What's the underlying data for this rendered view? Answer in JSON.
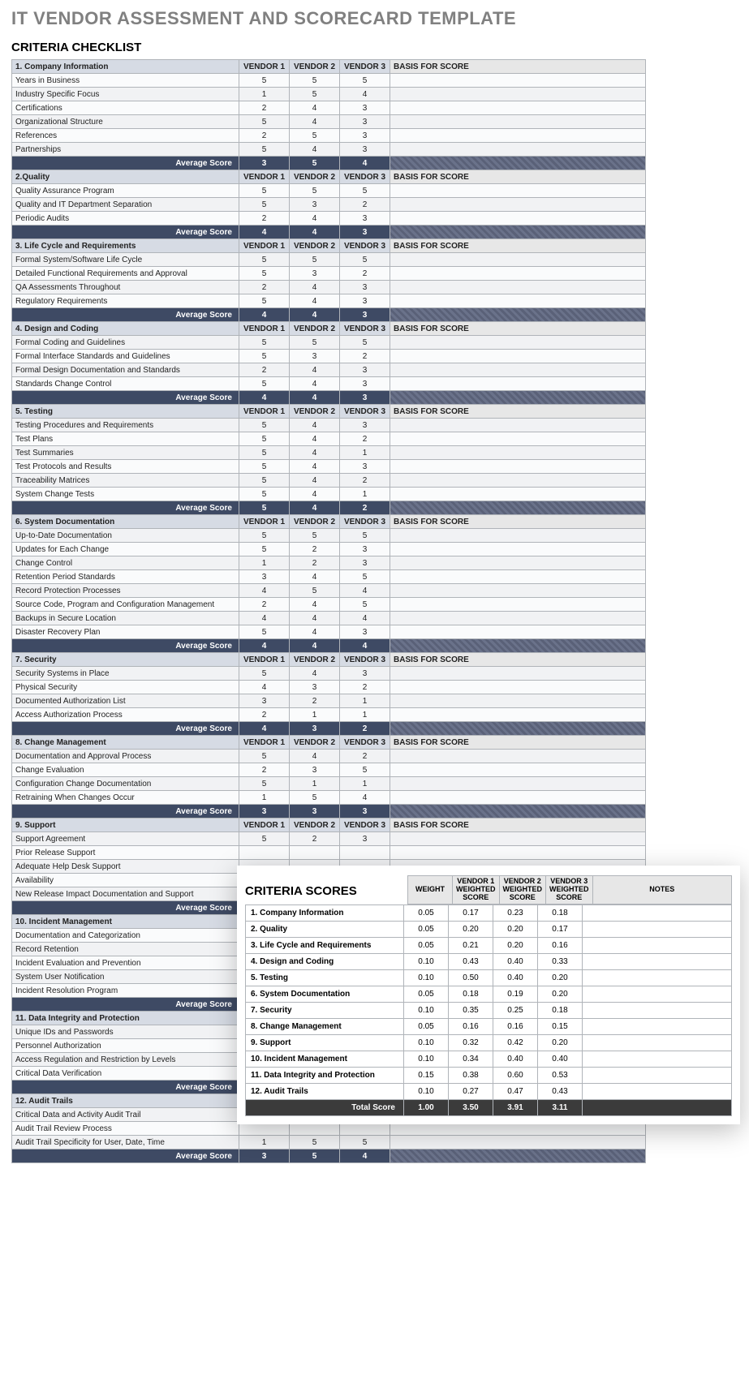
{
  "title": "IT VENDOR ASSESSMENT AND SCORECARD TEMPLATE",
  "checklist_title": "CRITERIA CHECKLIST",
  "col_headers": [
    "VENDOR 1",
    "VENDOR 2",
    "VENDOR 3",
    "BASIS FOR SCORE"
  ],
  "avg_label": "Average Score",
  "sections": [
    {
      "title": "1. Company Information",
      "avg": [
        "3",
        "5",
        "4"
      ],
      "rows": [
        {
          "l": "Years in Business",
          "v": [
            "5",
            "5",
            "5"
          ]
        },
        {
          "l": "Industry Specific Focus",
          "v": [
            "1",
            "5",
            "4"
          ]
        },
        {
          "l": "Certifications",
          "v": [
            "2",
            "4",
            "3"
          ]
        },
        {
          "l": "Organizational Structure",
          "v": [
            "5",
            "4",
            "3"
          ]
        },
        {
          "l": "References",
          "v": [
            "2",
            "5",
            "3"
          ]
        },
        {
          "l": "Partnerships",
          "v": [
            "5",
            "4",
            "3"
          ]
        }
      ]
    },
    {
      "title": "2.Quality",
      "avg": [
        "4",
        "4",
        "3"
      ],
      "rows": [
        {
          "l": "Quality Assurance Program",
          "v": [
            "5",
            "5",
            "5"
          ]
        },
        {
          "l": "Quality and IT Department Separation",
          "v": [
            "5",
            "3",
            "2"
          ]
        },
        {
          "l": "Periodic Audits",
          "v": [
            "2",
            "4",
            "3"
          ]
        }
      ]
    },
    {
      "title": "3. Life Cycle and Requirements",
      "avg": [
        "4",
        "4",
        "3"
      ],
      "rows": [
        {
          "l": "Formal System/Software Life Cycle",
          "v": [
            "5",
            "5",
            "5"
          ]
        },
        {
          "l": "Detailed Functional Requirements and Approval",
          "v": [
            "5",
            "3",
            "2"
          ]
        },
        {
          "l": "QA Assessments Throughout",
          "v": [
            "2",
            "4",
            "3"
          ]
        },
        {
          "l": "Regulatory Requirements",
          "v": [
            "5",
            "4",
            "3"
          ]
        }
      ]
    },
    {
      "title": "4. Design and Coding",
      "avg": [
        "4",
        "4",
        "3"
      ],
      "rows": [
        {
          "l": "Formal Coding and Guidelines",
          "v": [
            "5",
            "5",
            "5"
          ]
        },
        {
          "l": "Formal Interface Standards and Guidelines",
          "v": [
            "5",
            "3",
            "2"
          ]
        },
        {
          "l": "Formal Design Documentation and Standards",
          "v": [
            "2",
            "4",
            "3"
          ]
        },
        {
          "l": "Standards Change Control",
          "v": [
            "5",
            "4",
            "3"
          ]
        }
      ]
    },
    {
      "title": "5. Testing",
      "avg": [
        "5",
        "4",
        "2"
      ],
      "rows": [
        {
          "l": "Testing Procedures and Requirements",
          "v": [
            "5",
            "4",
            "3"
          ]
        },
        {
          "l": "Test Plans",
          "v": [
            "5",
            "4",
            "2"
          ]
        },
        {
          "l": "Test Summaries",
          "v": [
            "5",
            "4",
            "1"
          ]
        },
        {
          "l": "Test Protocols and Results",
          "v": [
            "5",
            "4",
            "3"
          ]
        },
        {
          "l": "Traceability Matrices",
          "v": [
            "5",
            "4",
            "2"
          ]
        },
        {
          "l": "System Change Tests",
          "v": [
            "5",
            "4",
            "1"
          ]
        }
      ]
    },
    {
      "title": "6. System Documentation",
      "avg": [
        "4",
        "4",
        "4"
      ],
      "rows": [
        {
          "l": "Up-to-Date Documentation",
          "v": [
            "5",
            "5",
            "5"
          ]
        },
        {
          "l": "Updates for Each Change",
          "v": [
            "5",
            "2",
            "3"
          ]
        },
        {
          "l": "Change Control",
          "v": [
            "1",
            "2",
            "3"
          ]
        },
        {
          "l": "Retention Period Standards",
          "v": [
            "3",
            "4",
            "5"
          ]
        },
        {
          "l": "Record Protection Processes",
          "v": [
            "4",
            "5",
            "4"
          ]
        },
        {
          "l": "Source Code, Program and Configuration Management",
          "v": [
            "2",
            "4",
            "5"
          ]
        },
        {
          "l": "Backups in Secure Location",
          "v": [
            "4",
            "4",
            "4"
          ]
        },
        {
          "l": "Disaster Recovery Plan",
          "v": [
            "5",
            "4",
            "3"
          ]
        }
      ]
    },
    {
      "title": "7. Security",
      "avg": [
        "4",
        "3",
        "2"
      ],
      "rows": [
        {
          "l": "Security Systems in Place",
          "v": [
            "5",
            "4",
            "3"
          ]
        },
        {
          "l": "Physical Security",
          "v": [
            "4",
            "3",
            "2"
          ]
        },
        {
          "l": "Documented Authorization List",
          "v": [
            "3",
            "2",
            "1"
          ]
        },
        {
          "l": "Access Authorization Process",
          "v": [
            "2",
            "1",
            "1"
          ]
        }
      ]
    },
    {
      "title": "8. Change Management",
      "avg": [
        "3",
        "3",
        "3"
      ],
      "rows": [
        {
          "l": "Documentation and Approval Process",
          "v": [
            "5",
            "4",
            "2"
          ]
        },
        {
          "l": "Change Evaluation",
          "v": [
            "2",
            "3",
            "5"
          ]
        },
        {
          "l": "Configuration Change Documentation",
          "v": [
            "5",
            "1",
            "1"
          ]
        },
        {
          "l": "Retraining When Changes Occur",
          "v": [
            "1",
            "5",
            "4"
          ]
        }
      ]
    },
    {
      "title": "9. Support",
      "avg": [
        "",
        "",
        ""
      ],
      "rows": [
        {
          "l": "Support Agreement",
          "v": [
            "5",
            "2",
            "3"
          ]
        },
        {
          "l": "Prior Release Support",
          "v": [
            "",
            "",
            ""
          ]
        },
        {
          "l": "Adequate Help Desk Support",
          "v": [
            "",
            "",
            ""
          ]
        },
        {
          "l": "Availability",
          "v": [
            "",
            "",
            ""
          ]
        },
        {
          "l": "New Release Impact Documentation and Support",
          "v": [
            "",
            "",
            ""
          ]
        }
      ]
    },
    {
      "title": "10. Incident Management",
      "avg": [
        "",
        "",
        ""
      ],
      "rows": [
        {
          "l": "Documentation and Categorization",
          "v": [
            "",
            "",
            ""
          ]
        },
        {
          "l": "Record Retention",
          "v": [
            "",
            "",
            ""
          ]
        },
        {
          "l": "Incident Evaluation and Prevention",
          "v": [
            "",
            "",
            ""
          ]
        },
        {
          "l": "System User Notification",
          "v": [
            "",
            "",
            ""
          ]
        },
        {
          "l": "Incident Resolution Program",
          "v": [
            "",
            "",
            ""
          ]
        }
      ]
    },
    {
      "title": "11. Data Integrity and Protection",
      "avg": [
        "",
        "",
        ""
      ],
      "rows": [
        {
          "l": "Unique IDs and Passwords",
          "v": [
            "",
            "",
            ""
          ]
        },
        {
          "l": "Personnel Authorization",
          "v": [
            "",
            "",
            ""
          ]
        },
        {
          "l": "Access Regulation and Restriction by Levels",
          "v": [
            "",
            "",
            ""
          ]
        },
        {
          "l": "Critical Data Verification",
          "v": [
            "",
            "",
            ""
          ]
        }
      ]
    },
    {
      "title": "12. Audit Trails",
      "avg": [
        "3",
        "5",
        "4"
      ],
      "rows": [
        {
          "l": "Critical Data and Activity Audit Trail",
          "v": [
            "",
            "",
            ""
          ]
        },
        {
          "l": "Audit Trail Review Process",
          "v": [
            "",
            "",
            ""
          ]
        },
        {
          "l": "Audit Trail Specificity for User, Date, Time",
          "v": [
            "1",
            "5",
            "5"
          ]
        }
      ]
    }
  ],
  "overlay": {
    "title": "CRITERIA SCORES",
    "headers": [
      "WEIGHT",
      "VENDOR 1 WEIGHTED SCORE",
      "VENDOR 2 WEIGHTED SCORE",
      "VENDOR 3 WEIGHTED SCORE",
      "NOTES"
    ],
    "rows": [
      {
        "l": "1. Company Information",
        "v": [
          "0.05",
          "0.17",
          "0.23",
          "0.18"
        ]
      },
      {
        "l": "2. Quality",
        "v": [
          "0.05",
          "0.20",
          "0.20",
          "0.17"
        ]
      },
      {
        "l": "3. Life Cycle and Requirements",
        "v": [
          "0.05",
          "0.21",
          "0.20",
          "0.16"
        ]
      },
      {
        "l": "4. Design and Coding",
        "v": [
          "0.10",
          "0.43",
          "0.40",
          "0.33"
        ]
      },
      {
        "l": "5. Testing",
        "v": [
          "0.10",
          "0.50",
          "0.40",
          "0.20"
        ]
      },
      {
        "l": "6. System Documentation",
        "v": [
          "0.05",
          "0.18",
          "0.19",
          "0.20"
        ]
      },
      {
        "l": "7. Security",
        "v": [
          "0.10",
          "0.35",
          "0.25",
          "0.18"
        ]
      },
      {
        "l": "8. Change Management",
        "v": [
          "0.05",
          "0.16",
          "0.16",
          "0.15"
        ]
      },
      {
        "l": "9. Support",
        "v": [
          "0.10",
          "0.32",
          "0.42",
          "0.20"
        ]
      },
      {
        "l": "10. Incident Management",
        "v": [
          "0.10",
          "0.34",
          "0.40",
          "0.40"
        ]
      },
      {
        "l": "11. Data Integrity and Protection",
        "v": [
          "0.15",
          "0.38",
          "0.60",
          "0.53"
        ]
      },
      {
        "l": "12. Audit Trails",
        "v": [
          "0.10",
          "0.27",
          "0.47",
          "0.43"
        ]
      }
    ],
    "total_label": "Total Score",
    "total": [
      "1.00",
      "3.50",
      "3.91",
      "3.11"
    ]
  }
}
